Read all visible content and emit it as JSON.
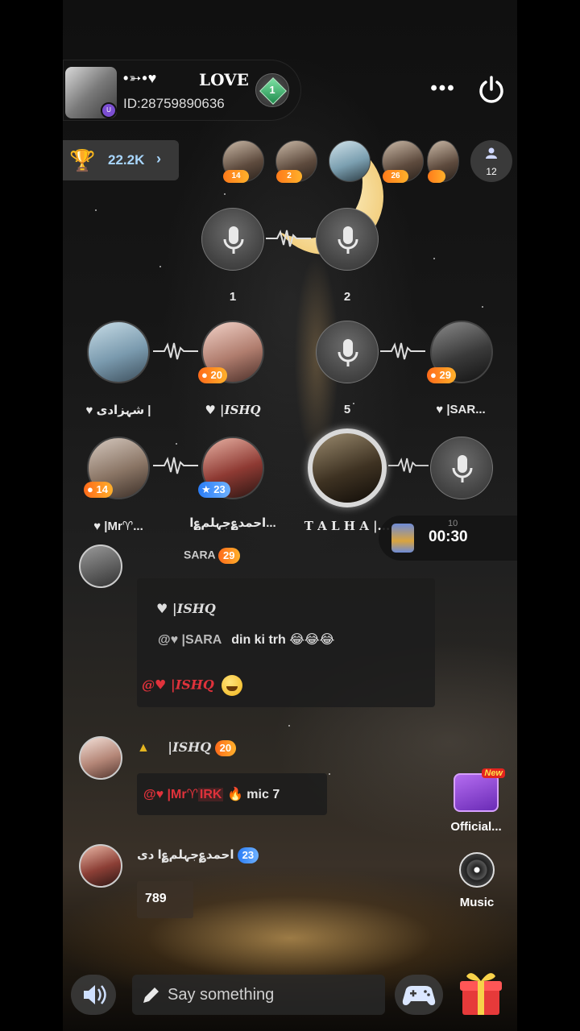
{
  "room": {
    "symbols": "•➳•♥",
    "title": "LOVE",
    "id_text": "ID:28759890636",
    "level": "1",
    "avatar_badge": "U"
  },
  "header": {
    "more_label": "•••"
  },
  "trophy": {
    "value": "22.2K",
    "chevron": "›"
  },
  "viewers": [
    {
      "level": "14"
    },
    {
      "level": "2"
    },
    {
      "level": ""
    },
    {
      "level": "26"
    },
    {
      "level": ""
    }
  ],
  "viewer_count": "12",
  "seats": {
    "s1_number": "1",
    "s2_number": "2",
    "s3_label": "♥ شہزادی |",
    "s4_label": "♥ |ISHQ",
    "s4_level": "20",
    "s5_number": "5",
    "s6_label": "♥ |SAR...",
    "s6_level": "29",
    "s7_label": "♥ |Mr♈...",
    "s7_level": "14",
    "s8_label": "احمد؏جہلم؏ا...",
    "s8_level": "23",
    "s9_label": "T A L H A |...",
    "s10_number": "10"
  },
  "timer": {
    "time": "00:30"
  },
  "chat": {
    "m0_partial": "SARA",
    "m0_level": "29",
    "m1_line1": "♥ |ISHQ",
    "m1_line2_prefix": "@♥ |SARA",
    "m1_line2_text": "din ki trh 😂😂😂",
    "m1_line3": "@♥ |ISHQ",
    "m2_name": "|ISHQ",
    "m2_level": "20",
    "m2_text_prefix": "@♥ |Mr♈",
    "m2_text_tag": "IRK",
    "m2_text": "🔥 mic 7",
    "m3_name": "احمد؏جہلم؏ا دی",
    "m3_level": "23",
    "m3_counter": "789"
  },
  "widgets": {
    "official_label": "Official...",
    "official_new": "New",
    "music_label": "Music"
  },
  "bottom": {
    "input_placeholder": "Say something"
  }
}
